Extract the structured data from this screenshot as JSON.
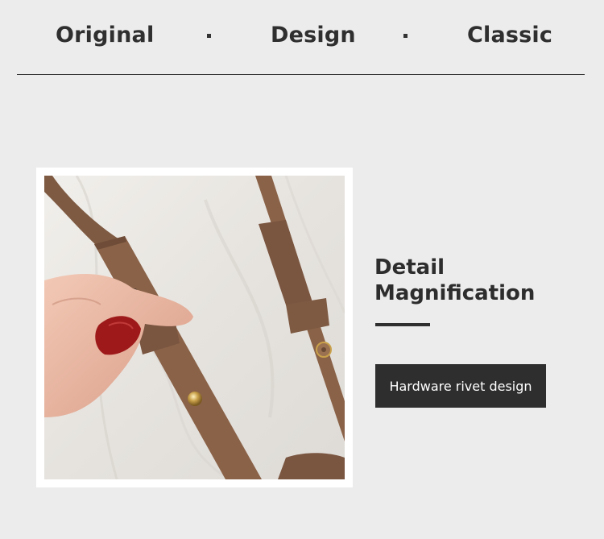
{
  "header": {
    "words": [
      "Original",
      "Design",
      "Classic"
    ]
  },
  "detail": {
    "title_line1": "Detail",
    "title_line2": "Magnification",
    "tag_label": "Hardware rivet design"
  },
  "colors": {
    "background": "#ececec",
    "text": "#2f2f2f",
    "tag_background": "#2e2e2e",
    "strap": "#8a6248"
  }
}
